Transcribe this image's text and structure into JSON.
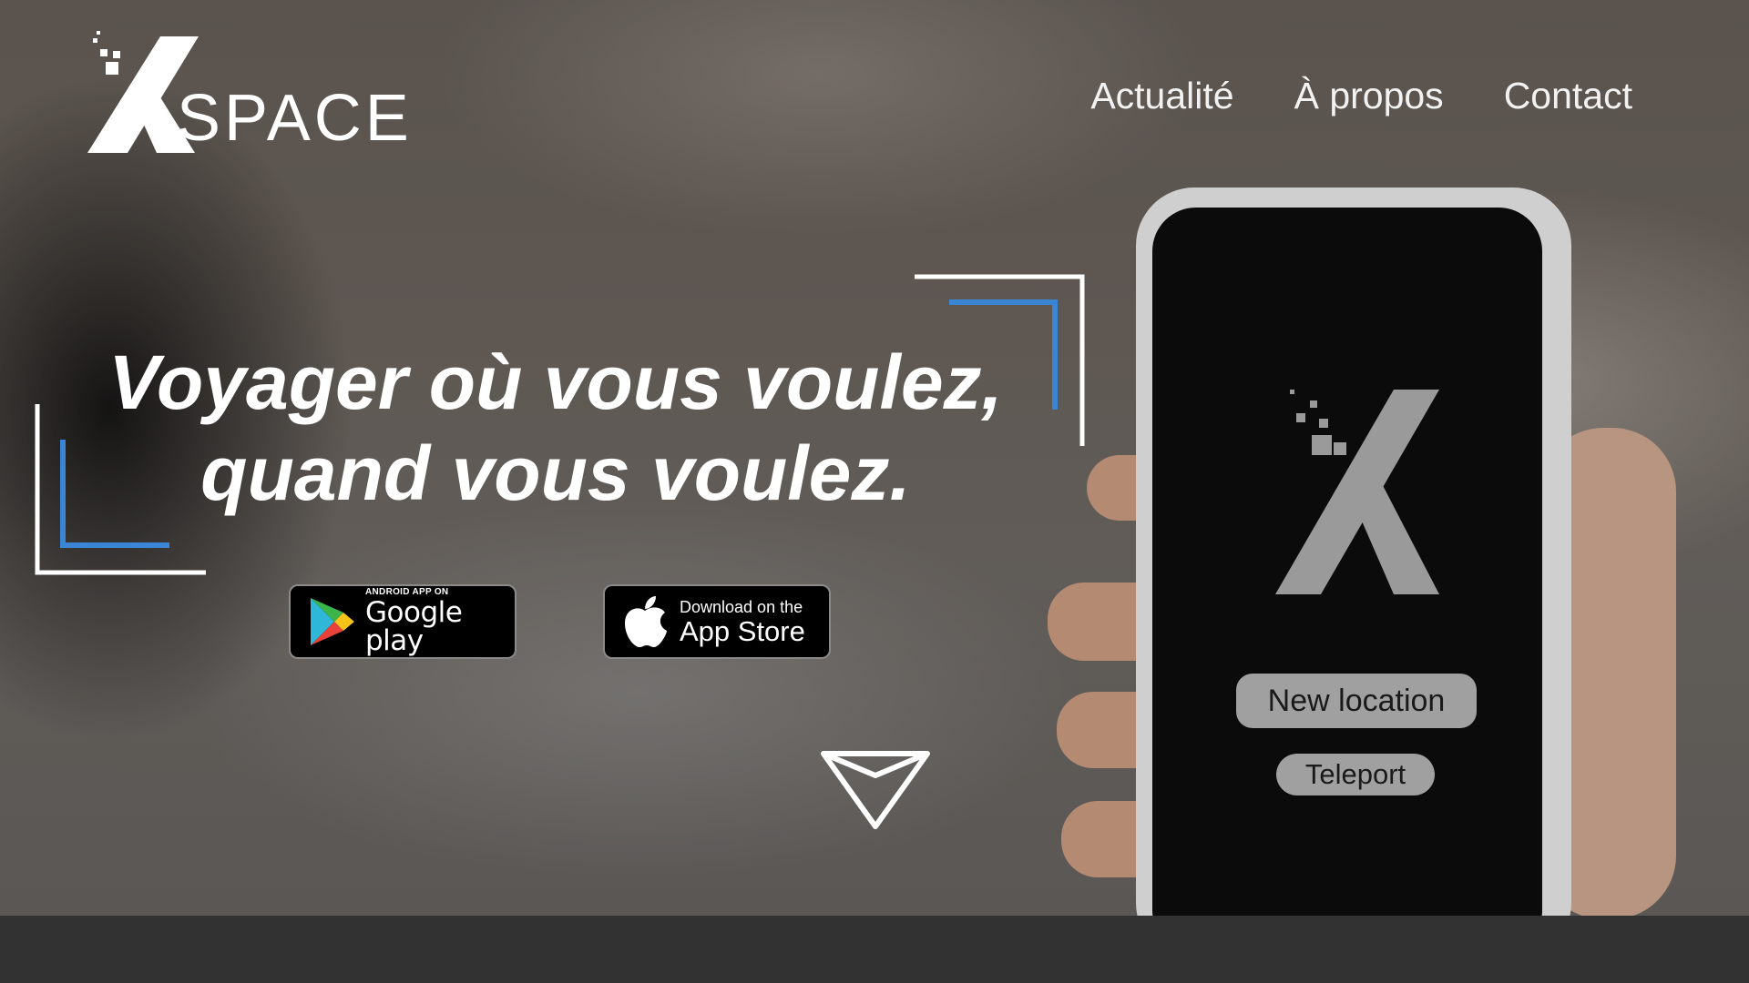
{
  "brand": {
    "logo_text": "SPACE",
    "logo_mark": "X"
  },
  "nav": {
    "items": [
      {
        "label": "Actualité"
      },
      {
        "label": "À propos"
      },
      {
        "label": "Contact"
      }
    ]
  },
  "hero": {
    "headline_line1": "Voyager où vous voulez,",
    "headline_line2": "quand vous voulez."
  },
  "badges": {
    "google_play": {
      "small": "ANDROID APP ON",
      "big": "Google play"
    },
    "app_store": {
      "small": "Download on the",
      "big": "App Store"
    }
  },
  "phone": {
    "new_location_label": "New location",
    "teleport_label": "Teleport"
  },
  "colors": {
    "accent_blue": "#3a86d4",
    "text_white": "#ffffff",
    "bottom_bar": "#323232"
  },
  "icons": {
    "scroll": "chevron-down-triangle-icon",
    "google_play": "google-play-icon",
    "apple": "apple-icon"
  }
}
